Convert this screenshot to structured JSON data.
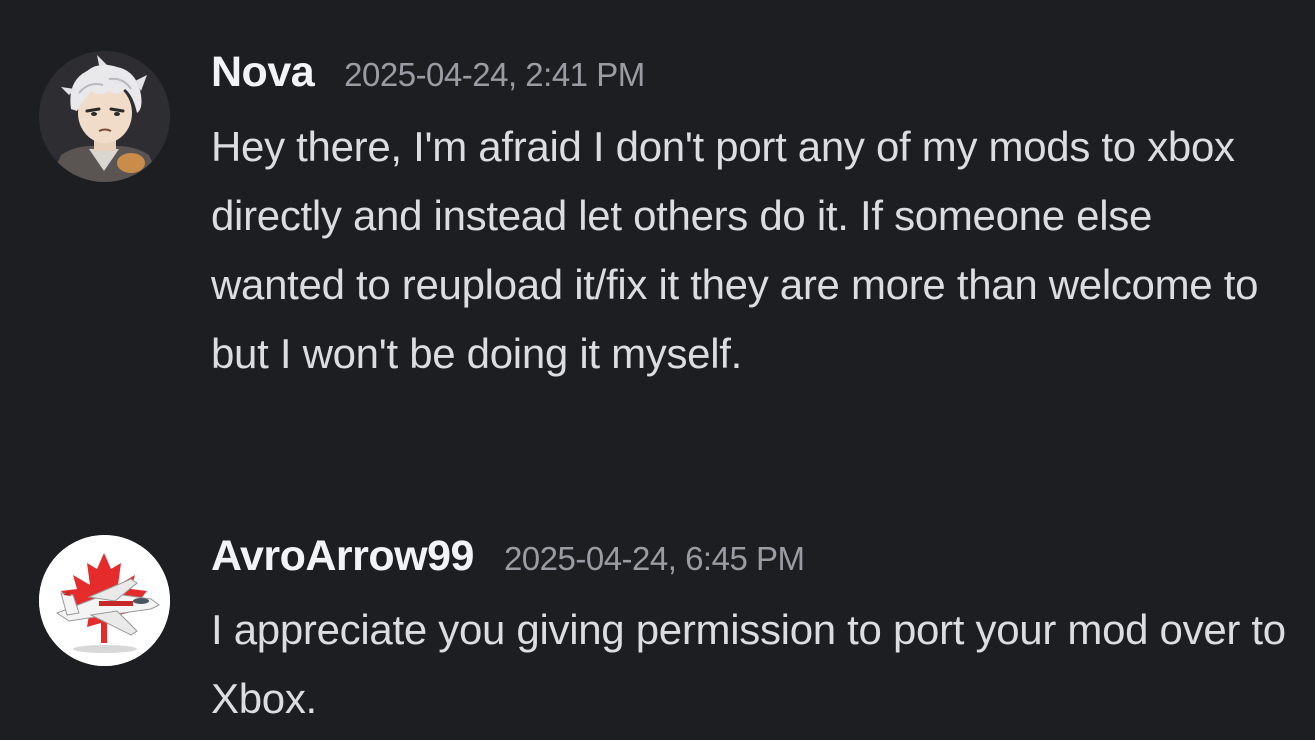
{
  "messages": [
    {
      "username": "Nova",
      "timestamp": "2025-04-24, 2:41 PM",
      "avatar": "anime-character-avatar",
      "content": "Hey there, I'm afraid I don't port any of my mods to xbox directly and instead let others do it. If someone else wanted to reupload it/fix it they are more than welcome to but I won't be doing it myself."
    },
    {
      "username": "AvroArrow99",
      "timestamp": "2025-04-24, 6:45 PM",
      "avatar": "avro-arrow-jet-maple-leaf-avatar",
      "content": "I appreciate you giving permission to port your mod over to Xbox."
    }
  ],
  "colors": {
    "background": "#1d1e22",
    "username": "#f2f3f5",
    "timestamp": "#9a9ca4",
    "message_text": "#dbdde1",
    "maple_leaf": "#e52b2b"
  }
}
